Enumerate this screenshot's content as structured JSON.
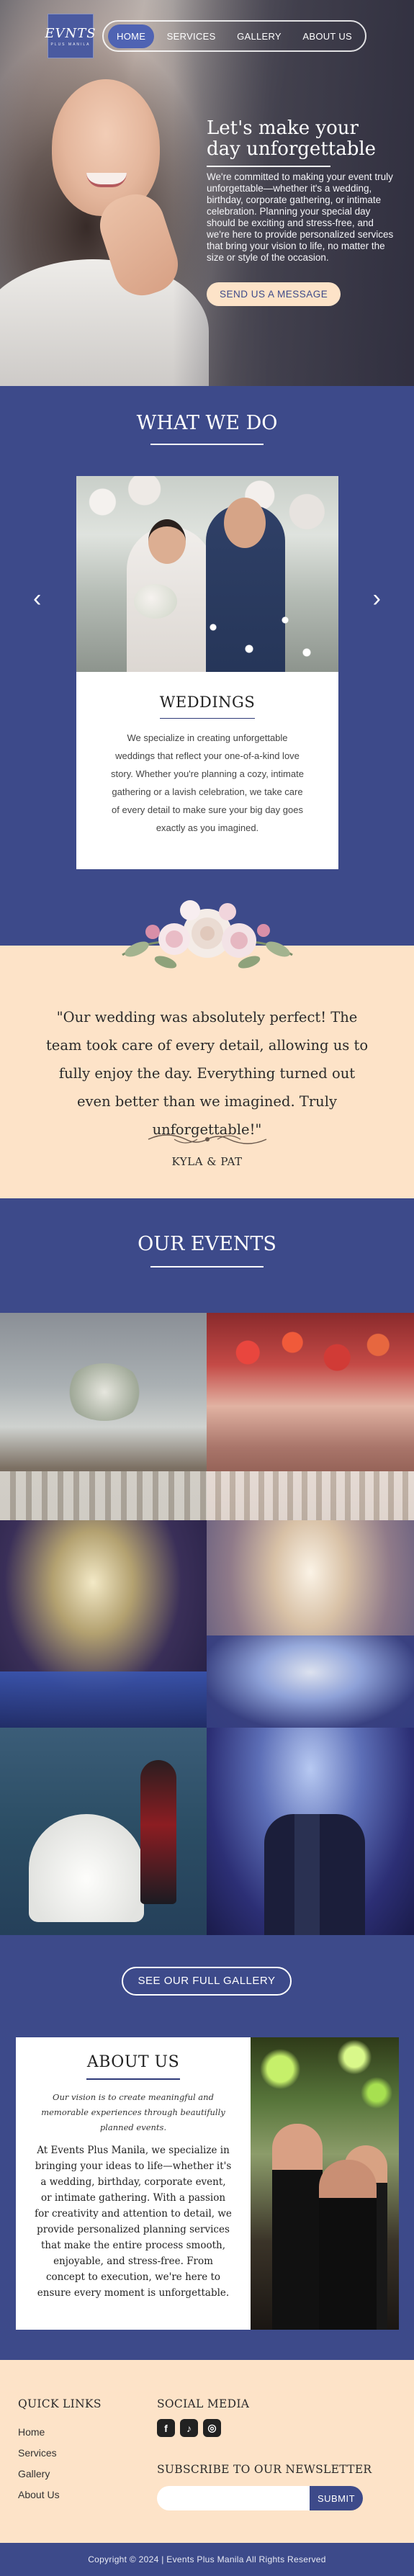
{
  "brand": {
    "logo_text": "EVNTS",
    "logo_subtext": "PLUS MANILA"
  },
  "nav": {
    "items": [
      "HOME",
      "SERVICES",
      "GALLERY",
      "ABOUT US"
    ],
    "active": "HOME"
  },
  "hero": {
    "title": "Let's make your day unforgettable",
    "body": "We're committed to making your event truly unforgettable—whether it's a wedding, birthday, corporate gathering, or intimate celebration. Planning your special day should be exciting and stress-free, and we're here to provide personalized services that bring your vision to life, no matter the size or style of the occasion.",
    "cta": "SEND US A MESSAGE"
  },
  "what_we_do": {
    "title": "WHAT WE DO",
    "card_title": "WEDDINGS",
    "card_body": "We specialize in creating unforgettable weddings that reflect your one-of-a-kind love story. Whether you're planning a cozy, intimate gathering or a lavish celebration, we take care of every detail to make sure your big day goes exactly as you imagined.",
    "prev": "‹",
    "next": "›"
  },
  "testimonial": {
    "quote": "\"Our wedding was absolutely perfect! The team took care of every detail, allowing us to fully enjoy the day. Everything turned out even better than we imagined. Truly unforgettable!\"",
    "author": "KYLA & PAT"
  },
  "events": {
    "title": "OUR EVENTS",
    "gallery_button": "SEE OUR FULL GALLERY"
  },
  "about": {
    "title": "ABOUT US",
    "lead": "Our vision is to create meaningful and memorable experiences through beautifully planned events.",
    "body": "At Events Plus Manila, we specialize in bringing your ideas to life—whether it's a wedding, birthday, corporate event, or intimate gathering. With a passion for creativity and attention to detail, we provide personalized planning services that make the entire process smooth, enjoyable, and stress-free. From concept to execution, we're here to ensure every moment is unforgettable."
  },
  "footer": {
    "quick_links_title": "QUICK LINKS",
    "links": [
      "Home",
      "Services",
      "Gallery",
      "About Us"
    ],
    "social_title": "SOCIAL MEDIA",
    "social_icons": [
      "facebook-icon",
      "tiktok-icon",
      "instagram-icon"
    ],
    "newsletter_title": "SUBSCRIBE TO OUR NEWSLETTER",
    "newsletter_placeholder": "",
    "submit_label": "SUBMIT",
    "copyright": "Copyright © 2024 | Events Plus Manila All Rights Reserved"
  },
  "colors": {
    "primary": "#3d4a8a",
    "accent_peach": "#fde3c8",
    "nav_active": "#4f63b3"
  }
}
